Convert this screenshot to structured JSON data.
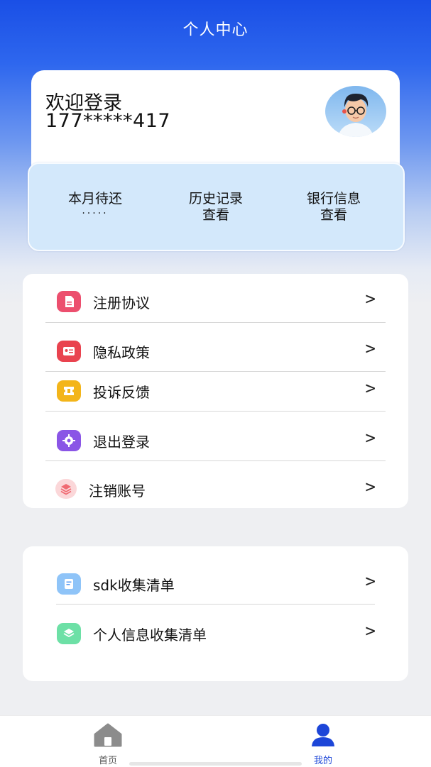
{
  "header": {
    "title": "个人中心"
  },
  "profile": {
    "welcome": "欢迎登录",
    "phone": "177*****417",
    "avatar_icon": "user-avatar-icon"
  },
  "stats": [
    {
      "label": "本月待还",
      "value": "·····"
    },
    {
      "label": "历史记录",
      "value": "查看"
    },
    {
      "label": "银行信息",
      "value": "查看"
    }
  ],
  "menu_main": [
    {
      "label": "注册协议",
      "icon": "document-icon",
      "color": "#ec4f6e"
    },
    {
      "label": "隐私政策",
      "icon": "id-card-icon",
      "color": "#e9434f"
    },
    {
      "label": "投诉反馈",
      "icon": "ticket-icon",
      "color": "#f3b51a"
    },
    {
      "label": "退出登录",
      "icon": "gear-icon",
      "color": "#8a55e6"
    },
    {
      "label": "注销账号",
      "icon": "layers-icon",
      "color": "#f28b90"
    }
  ],
  "menu_secondary": [
    {
      "label": "sdk收集清单",
      "icon": "receipt-icon",
      "color": "#5b9df3"
    },
    {
      "label": "个人信息收集清单",
      "icon": "stack-icon",
      "color": "#3fcf86"
    }
  ],
  "chevron": ">",
  "tabs": [
    {
      "label": "首页",
      "icon": "home-icon"
    },
    {
      "label": "我的",
      "icon": "person-icon"
    }
  ],
  "colors": {
    "accent": "#1d46d8",
    "header_blue": "#1a4fe6",
    "stats_bg": "#d3e8fb"
  }
}
